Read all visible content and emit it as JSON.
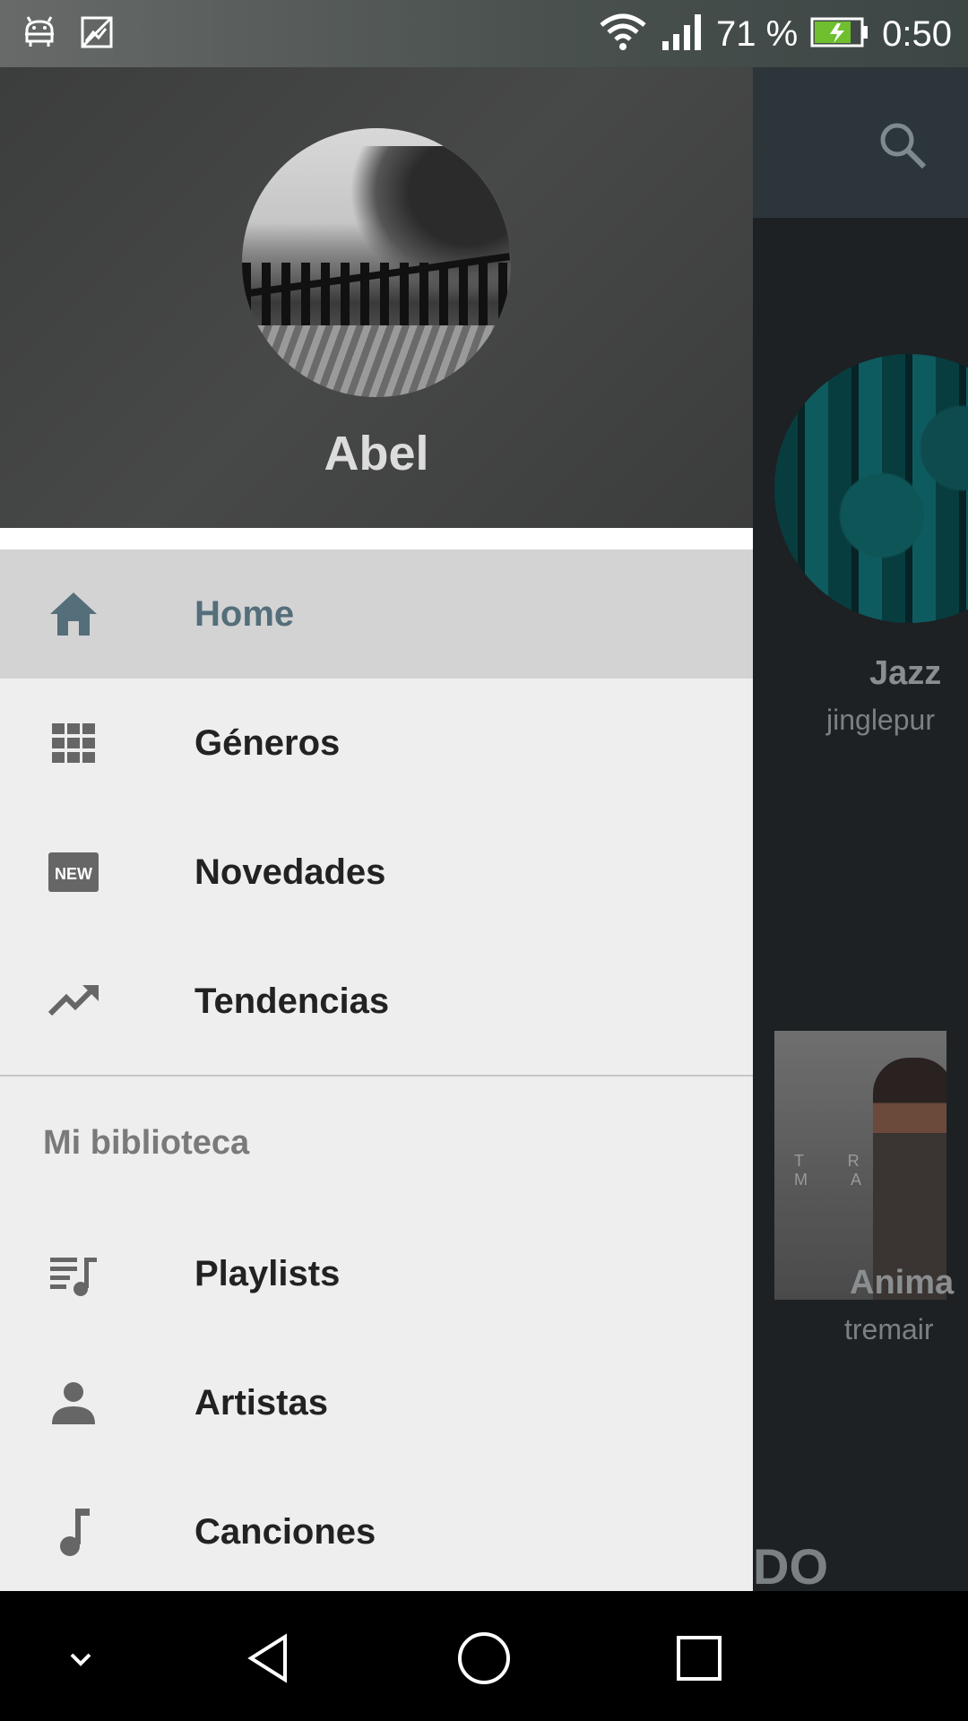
{
  "status_bar": {
    "battery_percent": "71 %",
    "time": "0:50",
    "icons": [
      "android-icon",
      "image-icon",
      "wifi-icon",
      "signal-icon",
      "battery-icon"
    ]
  },
  "background_app": {
    "cards": [
      {
        "title": "Jazz",
        "subtitle": "jinglepur"
      },
      {
        "title": "Anima",
        "subtitle": "tremair"
      }
    ],
    "album_text": "T R E M A",
    "section_heading": "DO"
  },
  "drawer": {
    "user_name": "Abel",
    "nav_items": [
      {
        "label": "Home",
        "icon": "home-icon",
        "active": true
      },
      {
        "label": "Géneros",
        "icon": "grid-icon",
        "active": false
      },
      {
        "label": "Novedades",
        "icon": "new-badge-icon",
        "active": false
      },
      {
        "label": "Tendencias",
        "icon": "trending-icon",
        "active": false
      }
    ],
    "library_header": "Mi biblioteca",
    "library_items": [
      {
        "label": "Playlists",
        "icon": "playlist-icon"
      },
      {
        "label": "Artistas",
        "icon": "person-icon"
      },
      {
        "label": "Canciones",
        "icon": "music-note-icon"
      }
    ]
  },
  "colors": {
    "active_accent": "#546e7a",
    "drawer_bg": "#eeeeee",
    "active_row_bg": "#d3d3d3",
    "header_bg": "#414242"
  }
}
